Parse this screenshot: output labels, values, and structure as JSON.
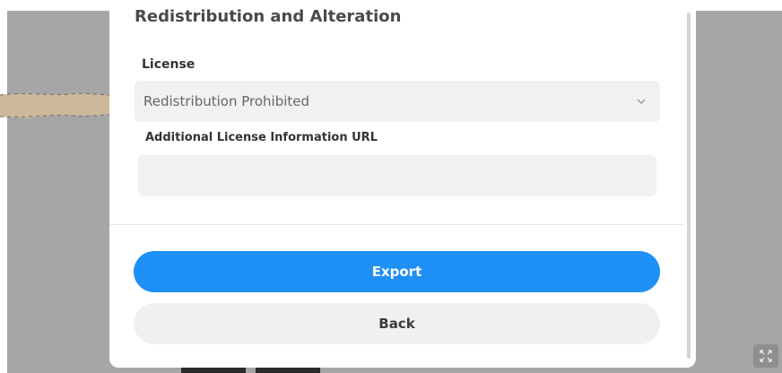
{
  "section": {
    "title": "Redistribution and Alteration"
  },
  "license": {
    "label": "License",
    "selected": "Redistribution Prohibited"
  },
  "additional_url": {
    "label": "Additional License Information URL",
    "value": "",
    "placeholder": ""
  },
  "actions": {
    "export_label": "Export",
    "back_label": "Back"
  },
  "colors": {
    "accent": "#1e90f5",
    "backdrop": "#a6a6a6",
    "field_bg": "#f1f1f1"
  },
  "icons": {
    "select_arrow": "chevron-down-icon",
    "fullscreen": "fullscreen-icon"
  }
}
